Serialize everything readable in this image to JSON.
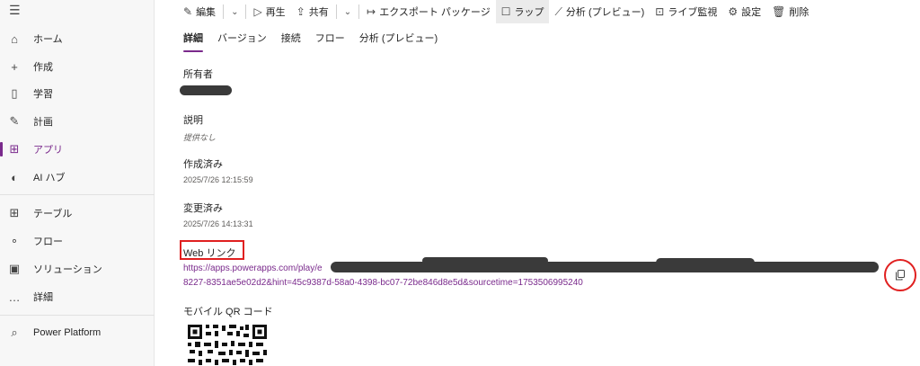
{
  "sidebar": {
    "items": [
      {
        "label": "ホーム",
        "icon": "home-icon",
        "glyph": "⌂"
      },
      {
        "label": "作成",
        "icon": "plus-icon",
        "glyph": "+"
      },
      {
        "label": "学習",
        "icon": "book-icon",
        "glyph": "▯"
      },
      {
        "label": "計画",
        "icon": "plan-icon",
        "glyph": "✎"
      },
      {
        "label": "アプリ",
        "icon": "apps-icon",
        "glyph": "⊞"
      },
      {
        "label": "AI ハブ",
        "icon": "ai-hub-icon",
        "glyph": "◐"
      },
      {
        "label": "テーブル",
        "icon": "table-icon",
        "glyph": "⊞"
      },
      {
        "label": "フロー",
        "icon": "flow-icon",
        "glyph": "∘"
      },
      {
        "label": "ソリューション",
        "icon": "solution-icon",
        "glyph": "▣"
      },
      {
        "label": "詳細",
        "icon": "more-icon",
        "glyph": "…"
      },
      {
        "label": "Power Platform",
        "icon": "power-platform-icon",
        "glyph": "⌕"
      }
    ],
    "active_index": 4
  },
  "toolbar": {
    "edit": "編集",
    "play": "再生",
    "share": "共有",
    "export": "エクスポート パッケージ",
    "wrap": "ラップ",
    "analytics": "分析 (プレビュー)",
    "live_monitor": "ライブ監視",
    "settings": "設定",
    "delete": "削除"
  },
  "tabs": [
    "詳細",
    "バージョン",
    "接続",
    "フロー",
    "分析 (プレビュー)"
  ],
  "details": {
    "owner_label": "所有者",
    "description_label": "説明",
    "description_value": "提供なし",
    "created_label": "作成済み",
    "created_value": "2025/7/26 12:15:59",
    "modified_label": "変更済み",
    "modified_value": "2025/7/26 14:13:31",
    "web_link_label": "Web リンク",
    "web_link_line1": "https://apps.powerapps.com/play/e",
    "web_link_line2": "8227-8351ae5e02d2&hint=45c9387d-58a0-4398-bc07-72be846d8e5d&sourcetime=1753506995240",
    "qr_label": "モバイル QR コード"
  },
  "colors": {
    "accent": "#7a2a8c",
    "highlight": "#e02020"
  }
}
